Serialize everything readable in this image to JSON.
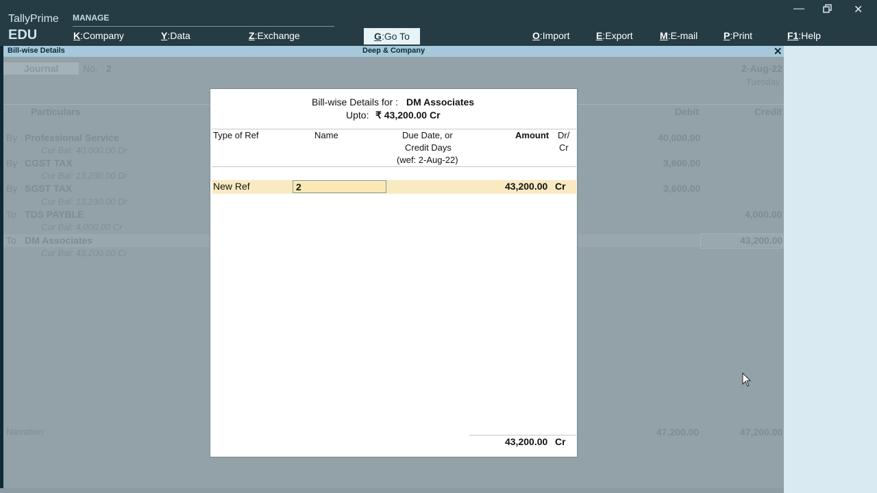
{
  "app": {
    "name": "TallyPrime",
    "edition": "EDU"
  },
  "topmenu": {
    "group_label": "MANAGE",
    "items": [
      {
        "key": "K",
        "label": "Company"
      },
      {
        "key": "Y",
        "label": "Data"
      },
      {
        "key": "Z",
        "label": "Exchange"
      },
      {
        "key": "G",
        "label": "Go To"
      },
      {
        "key": "O",
        "label": "Import"
      },
      {
        "key": "E",
        "label": "Export"
      },
      {
        "key": "M",
        "label": "E-mail"
      },
      {
        "key": "P",
        "label": "Print"
      },
      {
        "key": "F1",
        "label": "Help"
      }
    ]
  },
  "titlebar": {
    "left": "Bill-wise Details",
    "center": "Deep & Company",
    "close": "✕"
  },
  "voucher": {
    "type": "Journal",
    "no_label": "No.",
    "no": "2",
    "date": "2-Aug-22",
    "day": "Tuesday",
    "headers": {
      "particulars": "Particulars",
      "debit": "Debit",
      "credit": "Credit"
    },
    "rows": [
      {
        "prefix": "By",
        "name": "Professional Service",
        "bal": "Cur Bal: 40,000.00 Dr",
        "debit": "40,000.00",
        "credit": ""
      },
      {
        "prefix": "By",
        "name": "CGST TAX",
        "bal": "Cur Bal: 13,230.00 Dr",
        "debit": "3,600.00",
        "credit": ""
      },
      {
        "prefix": "By",
        "name": "SGST TAX",
        "bal": "Cur Bal: 13,230.00 Dr",
        "debit": "3,600.00",
        "credit": ""
      },
      {
        "prefix": "To",
        "name": "TDS PAYBLE",
        "bal": "Cur Bal: 4,000.00 Cr",
        "debit": "",
        "credit": "4,000.00"
      },
      {
        "prefix": "To",
        "name": "DM Associates",
        "bal": "Cur Bal: 43,200.00 Cr",
        "debit": "",
        "credit": "43,200.00"
      }
    ],
    "narration_label": "Narration:",
    "total_debit": "47,200.00",
    "total_credit": "47,200.00"
  },
  "modal": {
    "title_prefix": "Bill-wise Details for :",
    "party": "DM Associates",
    "upto_label": "Upto:",
    "upto_value": "₹ 43,200.00 Cr",
    "col_type": "Type of Ref",
    "col_name": "Name",
    "col_due1": "Due Date, or",
    "col_due2": "Credit Days",
    "col_due3": "(wef: 2-Aug-22)",
    "col_amount": "Amount",
    "col_drcr1": "Dr/",
    "col_drcr2": "Cr",
    "row": {
      "type": "New Ref",
      "name": "2",
      "amount": "43,200.00",
      "drcr": "Cr"
    },
    "total_amount": "43,200.00",
    "total_drcr": "Cr"
  },
  "colors": {
    "topbar": "#253c44",
    "titlestrip": "#a6c8db",
    "highlight": "#faeac2",
    "accent": "#e8f3f7"
  }
}
